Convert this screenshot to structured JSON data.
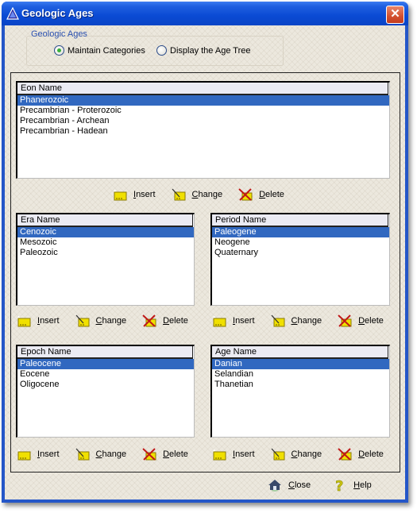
{
  "window": {
    "title": "Geologic Ages",
    "close_label": "✕"
  },
  "mode_group": {
    "label": "Geologic Ages",
    "options": [
      {
        "label": "Maintain Categories",
        "selected": true
      },
      {
        "label": "Display the Age Tree",
        "selected": false
      }
    ]
  },
  "lists": {
    "eon": {
      "header": "Eon Name",
      "items": [
        "Phanerozoic",
        "Precambrian - Proterozoic",
        "Precambrian - Archean",
        "Precambrian - Hadean"
      ],
      "selected": 0
    },
    "era": {
      "header": "Era Name",
      "items": [
        "Cenozoic",
        "Mesozoic",
        "Paleozoic"
      ],
      "selected": 0
    },
    "period": {
      "header": "Period Name",
      "items": [
        "Paleogene",
        "Neogene",
        "Quaternary"
      ],
      "selected": 0
    },
    "epoch": {
      "header": "Epoch Name",
      "items": [
        "Paleocene",
        "Eocene",
        "Oligocene"
      ],
      "selected": 0
    },
    "age": {
      "header": "Age Name",
      "items": [
        "Danian",
        "Selandian",
        "Thanetian"
      ],
      "selected": 0
    }
  },
  "actions": {
    "insert": {
      "key": "I",
      "rest": "nsert"
    },
    "change": {
      "key": "C",
      "rest": "hange"
    },
    "delete": {
      "key": "D",
      "rest": "elete"
    }
  },
  "footer": {
    "close": {
      "key": "C",
      "rest": "lose"
    },
    "help": {
      "key": "H",
      "rest": "elp"
    }
  }
}
